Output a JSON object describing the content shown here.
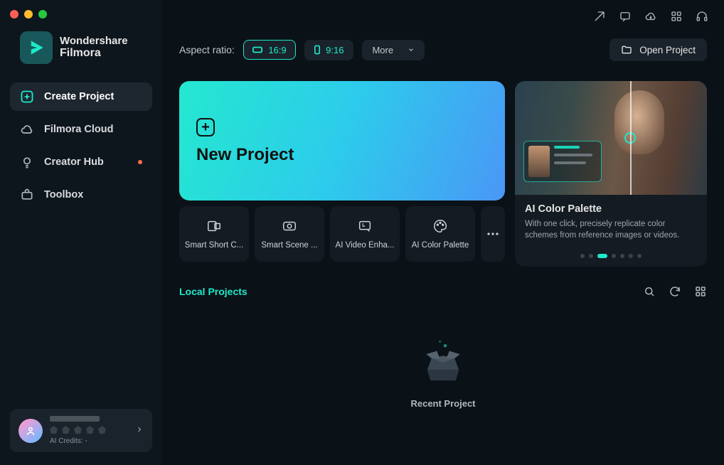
{
  "app": {
    "brand_top": "Wondershare",
    "brand_bottom": "Filmora"
  },
  "sidebar": {
    "items": [
      {
        "label": "Create Project"
      },
      {
        "label": "Filmora Cloud"
      },
      {
        "label": "Creator Hub"
      },
      {
        "label": "Toolbox"
      }
    ]
  },
  "topbar": {
    "aspect_label": "Aspect ratio:",
    "ratio_16_9": "16:9",
    "ratio_9_16": "9:16",
    "more": "More",
    "open_project": "Open Project"
  },
  "hero": {
    "new_project": "New Project",
    "tools": [
      {
        "label": "Smart Short C..."
      },
      {
        "label": "Smart Scene ..."
      },
      {
        "label": "AI Video Enha..."
      },
      {
        "label": "AI Color Palette"
      }
    ]
  },
  "feature": {
    "title": "AI Color Palette",
    "desc": "With one click, precisely replicate color schemes from reference images or videos.",
    "active_index": 2,
    "dot_count": 7
  },
  "projects": {
    "label": "Local Projects",
    "empty": "Recent Project"
  },
  "user": {
    "credits": "AI Credits: -"
  }
}
